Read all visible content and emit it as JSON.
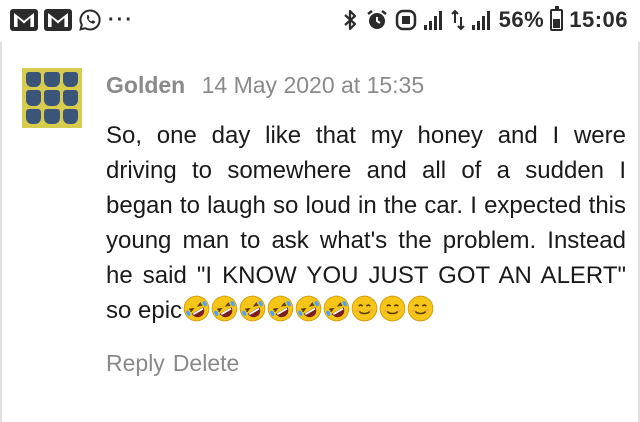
{
  "status_bar": {
    "notification_icons": [
      "gmail-icon",
      "gmail-icon",
      "whatsapp-icon"
    ],
    "overflow": "···",
    "system_icons": [
      "bluetooth-icon",
      "alarm-icon",
      "nfc-icon",
      "signal-icon",
      "data-transfer-icon",
      "signal-icon"
    ],
    "battery": "56%",
    "battery_level": 0.56,
    "time": "15:06"
  },
  "comment": {
    "author": "Golden",
    "date": "14 May 2020 at 15:35",
    "body": "So, one day like that my honey and I were driving to somewhere and all of a sudden I began to laugh so loud in the car. I expected this young man to ask what's the problem. Instead he said \"I KNOW YOU JUST GOT AN ALERT\" so epic",
    "emojis": [
      "rofl-emoji",
      "rofl-emoji",
      "rofl-emoji",
      "rofl-emoji",
      "rofl-emoji",
      "rofl-emoji",
      "smiling-face-emoji",
      "smiling-face-emoji",
      "smiling-face-emoji"
    ],
    "actions": {
      "reply": "Reply",
      "delete": "Delete"
    }
  },
  "colors": {
    "meta_text": "#8a8a8a",
    "body_text": "#1a1a1a",
    "avatar_bg": "#d8cc4f",
    "emoji": "#f5c518"
  }
}
